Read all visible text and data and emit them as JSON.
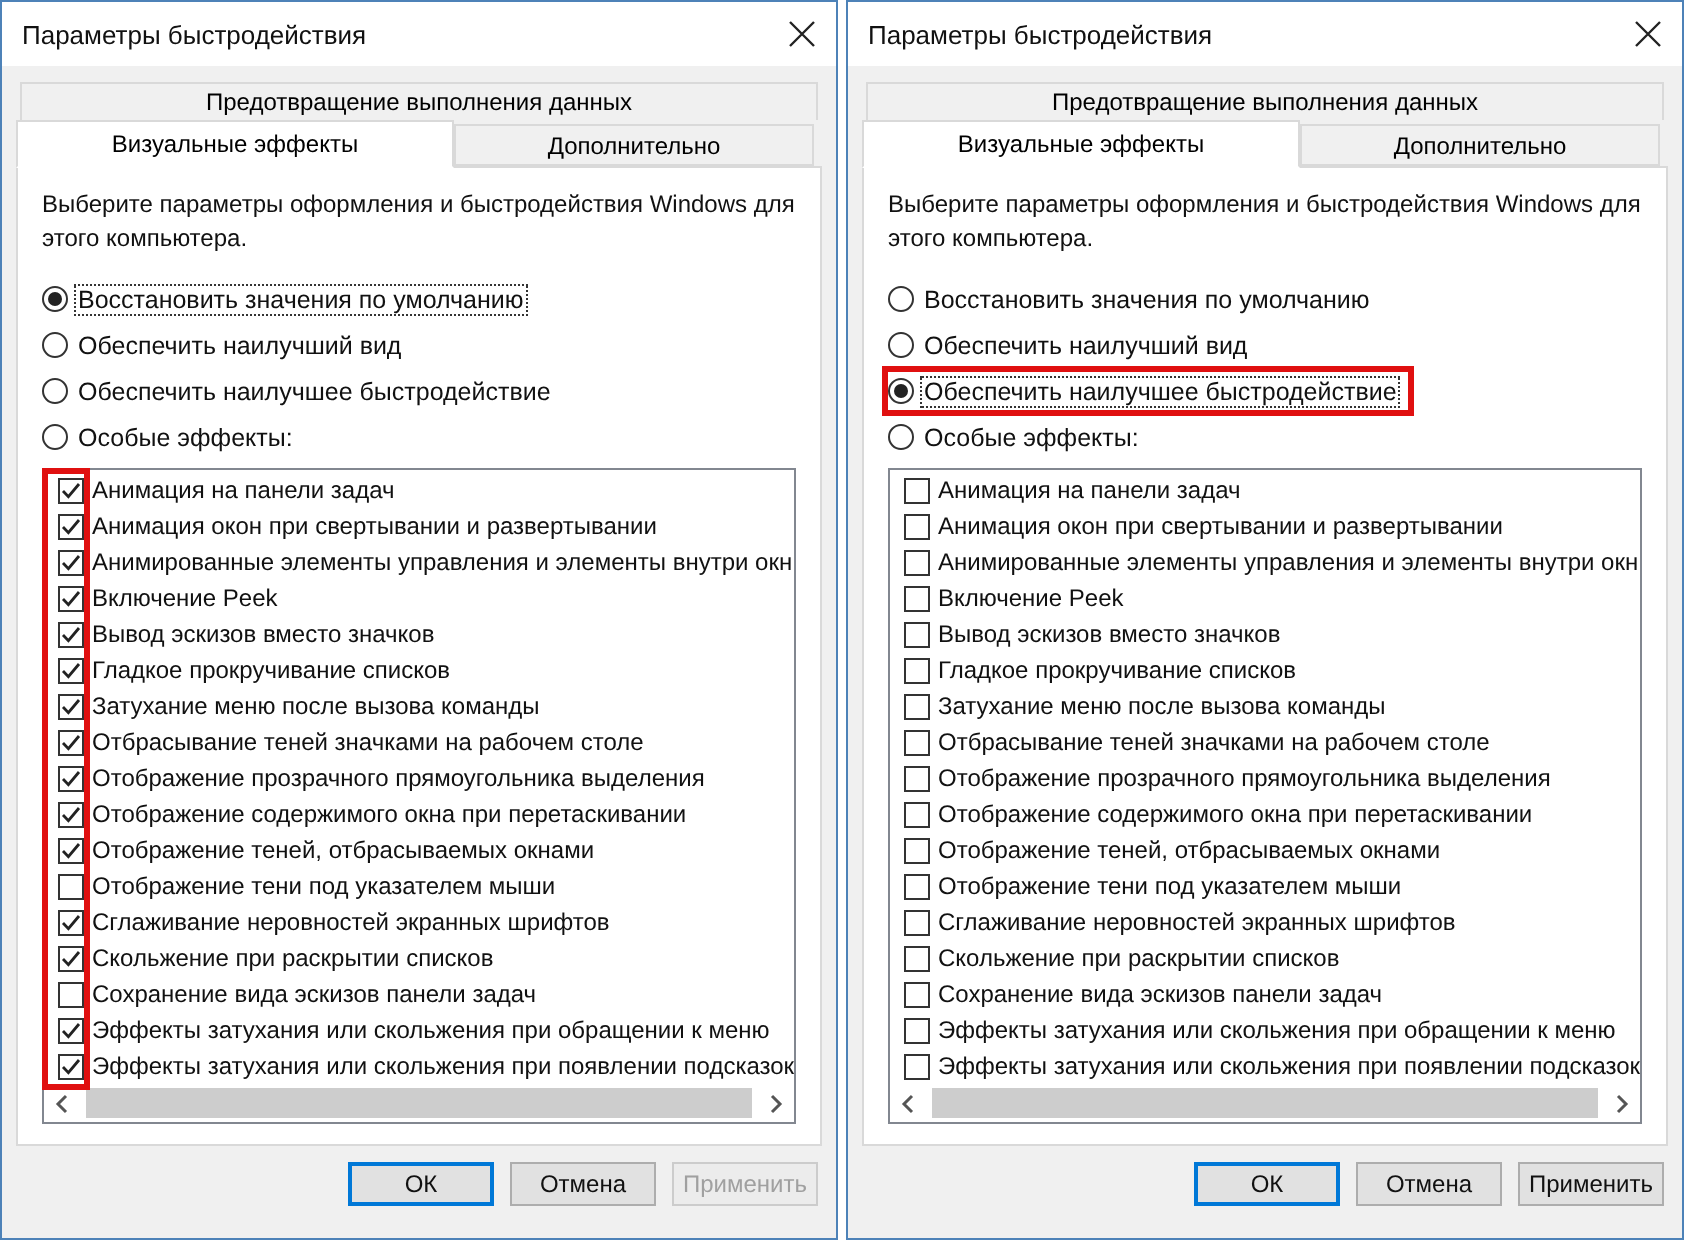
{
  "dialogs": [
    {
      "title": "Параметры быстродействия",
      "tabs_top": [
        {
          "label": "Предотвращение выполнения данных",
          "selected": false
        }
      ],
      "tabs": [
        {
          "label": "Визуальные эффекты",
          "selected": true
        },
        {
          "label": "Дополнительно",
          "selected": false
        }
      ],
      "description": "Выберите параметры оформления и быстродействия Windows для этого компьютера.",
      "options": [
        {
          "label": "Восстановить значения по умолчанию",
          "selected": true,
          "highlighted": false
        },
        {
          "label": "Обеспечить наилучший вид",
          "selected": false,
          "highlighted": false
        },
        {
          "label": "Обеспечить наилучшее быстродействие",
          "selected": false,
          "highlighted": false
        },
        {
          "label": "Особые эффекты:",
          "selected": false,
          "highlighted": false
        }
      ],
      "checkboxes_highlighted": true,
      "effects": [
        {
          "label": "Анимация на панели задач",
          "checked": true
        },
        {
          "label": "Анимация окон при свертывании и развертывании",
          "checked": true
        },
        {
          "label": "Анимированные элементы управления и элементы внутри окн",
          "checked": true
        },
        {
          "label": "Включение Peek",
          "checked": true
        },
        {
          "label": "Вывод эскизов вместо значков",
          "checked": true
        },
        {
          "label": "Гладкое прокручивание списков",
          "checked": true
        },
        {
          "label": "Затухание меню после вызова команды",
          "checked": true
        },
        {
          "label": "Отбрасывание теней значками на рабочем столе",
          "checked": true
        },
        {
          "label": "Отображение прозрачного прямоугольника выделения",
          "checked": true
        },
        {
          "label": "Отображение содержимого окна при перетаскивании",
          "checked": true
        },
        {
          "label": "Отображение теней, отбрасываемых окнами",
          "checked": true
        },
        {
          "label": "Отображение тени под указателем мыши",
          "checked": false
        },
        {
          "label": "Сглаживание неровностей экранных шрифтов",
          "checked": true
        },
        {
          "label": "Скольжение при раскрытии списков",
          "checked": true
        },
        {
          "label": "Сохранение вида эскизов панели задач",
          "checked": false
        },
        {
          "label": "Эффекты затухания или скольжения при обращении к меню",
          "checked": true
        },
        {
          "label": "Эффекты затухания или скольжения при появлении подсказок",
          "checked": true
        }
      ],
      "buttons": [
        {
          "label": "ОК",
          "kind": "default",
          "disabled": false
        },
        {
          "label": "Отмена",
          "kind": "normal",
          "disabled": false
        },
        {
          "label": "Применить",
          "kind": "normal",
          "disabled": true
        }
      ]
    },
    {
      "title": "Параметры быстродействия",
      "tabs_top": [
        {
          "label": "Предотвращение выполнения данных",
          "selected": false
        }
      ],
      "tabs": [
        {
          "label": "Визуальные эффекты",
          "selected": true
        },
        {
          "label": "Дополнительно",
          "selected": false
        }
      ],
      "description": "Выберите параметры оформления и быстродействия Windows для этого компьютера.",
      "options": [
        {
          "label": "Восстановить значения по умолчанию",
          "selected": false,
          "highlighted": false
        },
        {
          "label": "Обеспечить наилучший вид",
          "selected": false,
          "highlighted": false
        },
        {
          "label": "Обеспечить наилучшее быстродействие",
          "selected": true,
          "highlighted": true
        },
        {
          "label": "Особые эффекты:",
          "selected": false,
          "highlighted": false
        }
      ],
      "checkboxes_highlighted": false,
      "effects": [
        {
          "label": "Анимация на панели задач",
          "checked": false
        },
        {
          "label": "Анимация окон при свертывании и развертывании",
          "checked": false
        },
        {
          "label": "Анимированные элементы управления и элементы внутри окн",
          "checked": false
        },
        {
          "label": "Включение Peek",
          "checked": false
        },
        {
          "label": "Вывод эскизов вместо значков",
          "checked": false
        },
        {
          "label": "Гладкое прокручивание списков",
          "checked": false
        },
        {
          "label": "Затухание меню после вызова команды",
          "checked": false
        },
        {
          "label": "Отбрасывание теней значками на рабочем столе",
          "checked": false
        },
        {
          "label": "Отображение прозрачного прямоугольника выделения",
          "checked": false
        },
        {
          "label": "Отображение содержимого окна при перетаскивании",
          "checked": false
        },
        {
          "label": "Отображение теней, отбрасываемых окнами",
          "checked": false
        },
        {
          "label": "Отображение тени под указателем мыши",
          "checked": false
        },
        {
          "label": "Сглаживание неровностей экранных шрифтов",
          "checked": false
        },
        {
          "label": "Скольжение при раскрытии списков",
          "checked": false
        },
        {
          "label": "Сохранение вида эскизов панели задач",
          "checked": false
        },
        {
          "label": "Эффекты затухания или скольжения при обращении к меню",
          "checked": false
        },
        {
          "label": "Эффекты затухания или скольжения при появлении подсказок",
          "checked": false
        }
      ],
      "buttons": [
        {
          "label": "ОК",
          "kind": "default",
          "disabled": false
        },
        {
          "label": "Отмена",
          "kind": "normal",
          "disabled": false
        },
        {
          "label": "Применить",
          "kind": "normal",
          "disabled": false
        }
      ]
    }
  ]
}
